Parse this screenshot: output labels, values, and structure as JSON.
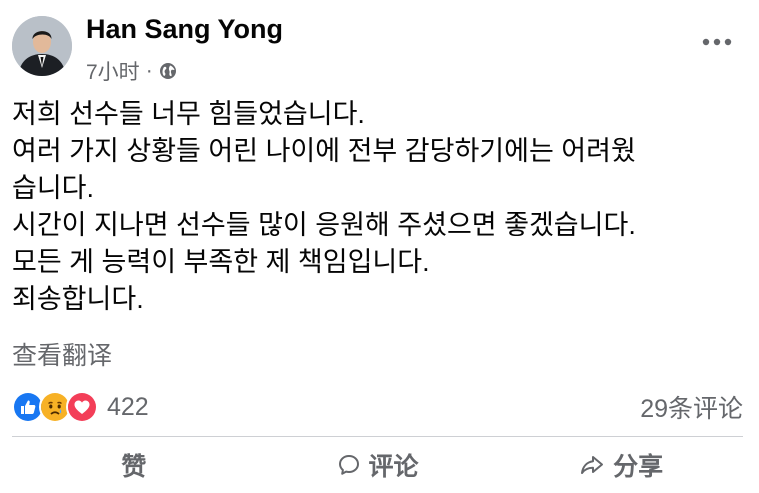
{
  "post": {
    "author": "Han Sang Yong",
    "time": "7小时",
    "separator": "·",
    "privacy_icon": "globe-icon",
    "more_icon": "more-options-icon",
    "message_lines": [
      "저희 선수들 너무 힘들었습니다.",
      "여러 가지 상황들 어린 나이에 전부 감당하기에는 어려웠",
      "습니다.",
      "시간이 지나면 선수들 많이 응원해 주셨으면 좋겠습니다.",
      "모든 게 능력이 부족한 제 책임입니다.",
      "죄송합니다."
    ],
    "see_translation": "查看翻译"
  },
  "reactions": {
    "icons": [
      "like-reaction-icon",
      "sad-reaction-icon",
      "love-reaction-icon"
    ],
    "count": "422",
    "comments": "29条评论"
  },
  "actions": {
    "like": "赞",
    "comment": "评论",
    "share": "分享"
  },
  "colors": {
    "text": "#050505",
    "secondary": "#65676b",
    "like_blue": "#1877f2",
    "love_red": "#f33e58",
    "sad_yellow": "#f7b125",
    "divider": "#ced0d4"
  }
}
